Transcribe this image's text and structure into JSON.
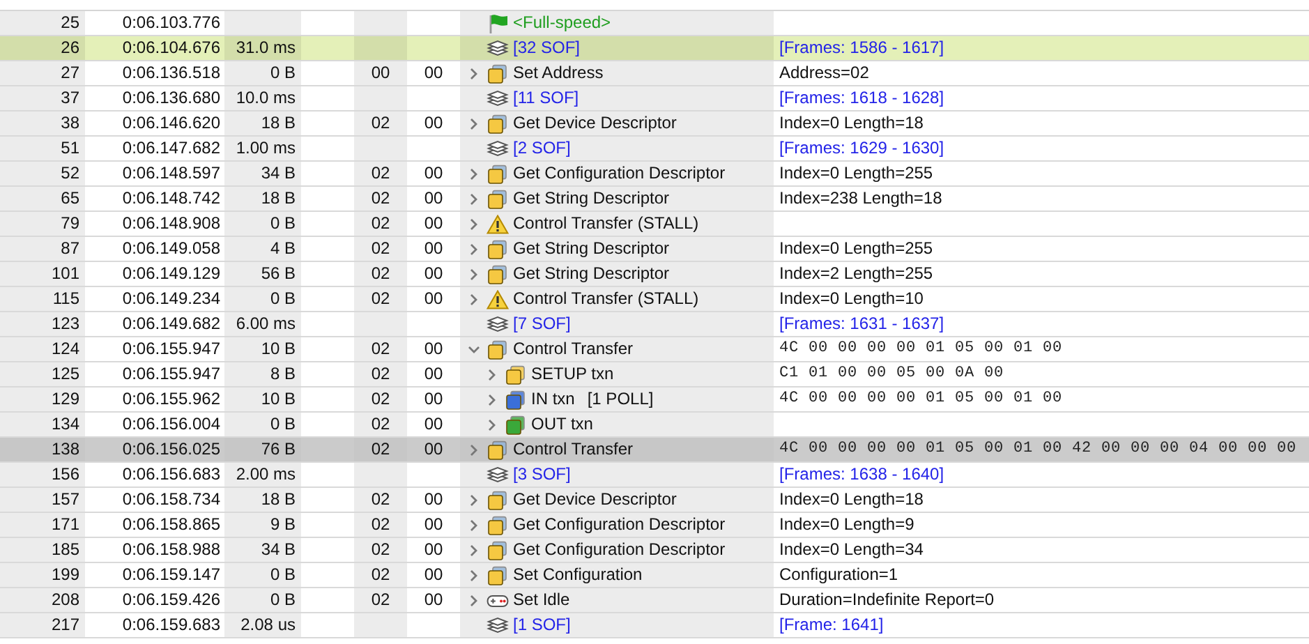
{
  "rows": [
    {
      "index": "25",
      "time": "0:06.103.776",
      "kind": "flag",
      "record": "<Full-speed>",
      "expandable": false,
      "selected": false,
      "highlighted": false
    },
    {
      "index": "26",
      "time": "0:06.104.676",
      "len": "31.0 ms",
      "kind": "sof",
      "record": "[32 SOF]",
      "summary": {
        "kind": "link",
        "text": "[Frames: 1586 - 1617]"
      },
      "expandable": false,
      "selected": false,
      "highlighted": true
    },
    {
      "index": "27",
      "time": "0:06.136.518",
      "len": "0 B",
      "dev": "00",
      "ep": "00",
      "kind": "transfer",
      "record": "Set Address",
      "summary": {
        "kind": "text",
        "text": "Address=02"
      },
      "expandable": true,
      "expanded": false,
      "selected": false,
      "highlighted": false
    },
    {
      "index": "37",
      "time": "0:06.136.680",
      "len": "10.0 ms",
      "kind": "sof",
      "record": "[11 SOF]",
      "summary": {
        "kind": "link",
        "text": "[Frames: 1618 - 1628]"
      },
      "expandable": false,
      "selected": false,
      "highlighted": false
    },
    {
      "index": "38",
      "time": "0:06.146.620",
      "len": "18 B",
      "dev": "02",
      "ep": "00",
      "kind": "transfer",
      "record": "Get Device Descriptor",
      "summary": {
        "kind": "text",
        "text": "Index=0 Length=18"
      },
      "expandable": true,
      "expanded": false,
      "selected": false,
      "highlighted": false
    },
    {
      "index": "51",
      "time": "0:06.147.682",
      "len": "1.00 ms",
      "kind": "sof",
      "record": "[2 SOF]",
      "summary": {
        "kind": "link",
        "text": "[Frames: 1629 - 1630]"
      },
      "expandable": false,
      "selected": false,
      "highlighted": false
    },
    {
      "index": "52",
      "time": "0:06.148.597",
      "len": "34 B",
      "dev": "02",
      "ep": "00",
      "kind": "transfer",
      "record": "Get Configuration Descriptor",
      "summary": {
        "kind": "text",
        "text": "Index=0 Length=255"
      },
      "expandable": true,
      "expanded": false,
      "selected": false,
      "highlighted": false
    },
    {
      "index": "65",
      "time": "0:06.148.742",
      "len": "18 B",
      "dev": "02",
      "ep": "00",
      "kind": "transfer",
      "record": "Get String Descriptor",
      "summary": {
        "kind": "text",
        "text": "Index=238 Length=18"
      },
      "expandable": true,
      "expanded": false,
      "selected": false,
      "highlighted": false
    },
    {
      "index": "79",
      "time": "0:06.148.908",
      "len": "0 B",
      "dev": "02",
      "ep": "00",
      "kind": "warning",
      "record": "Control Transfer (STALL)",
      "expandable": true,
      "expanded": false,
      "selected": false,
      "highlighted": false
    },
    {
      "index": "87",
      "time": "0:06.149.058",
      "len": "4 B",
      "dev": "02",
      "ep": "00",
      "kind": "transfer",
      "record": "Get String Descriptor",
      "summary": {
        "kind": "text",
        "text": "Index=0 Length=255"
      },
      "expandable": true,
      "expanded": false,
      "selected": false,
      "highlighted": false
    },
    {
      "index": "101",
      "time": "0:06.149.129",
      "len": "56 B",
      "dev": "02",
      "ep": "00",
      "kind": "transfer",
      "record": "Get String Descriptor",
      "summary": {
        "kind": "text",
        "text": "Index=2 Length=255"
      },
      "expandable": true,
      "expanded": false,
      "selected": false,
      "highlighted": false
    },
    {
      "index": "115",
      "time": "0:06.149.234",
      "len": "0 B",
      "dev": "02",
      "ep": "00",
      "kind": "warning",
      "record": "Control Transfer (STALL)",
      "summary": {
        "kind": "text",
        "text": "Index=0 Length=10"
      },
      "expandable": true,
      "expanded": false,
      "selected": false,
      "highlighted": false
    },
    {
      "index": "123",
      "time": "0:06.149.682",
      "len": "6.00 ms",
      "kind": "sof",
      "record": "[7 SOF]",
      "summary": {
        "kind": "link",
        "text": "[Frames: 1631 - 1637]"
      },
      "expandable": false,
      "selected": false,
      "highlighted": false
    },
    {
      "index": "124",
      "time": "0:06.155.947",
      "len": "10 B",
      "dev": "02",
      "ep": "00",
      "kind": "transfer",
      "record": "Control Transfer",
      "summary": {
        "kind": "hex",
        "text": "4C 00 00 00 00 01 05 00 01 00"
      },
      "expandable": true,
      "expanded": true,
      "selected": false,
      "highlighted": false,
      "children": [
        {
          "index": "125",
          "time": "0:06.155.947",
          "len": "8 B",
          "dev": "02",
          "ep": "00",
          "kind": "setup",
          "record": "SETUP txn",
          "summary": {
            "kind": "hex",
            "text": "C1 01 00 00 05 00 0A 00"
          },
          "expandable": true,
          "expanded": false,
          "selected": false,
          "highlighted": false
        },
        {
          "index": "129",
          "time": "0:06.155.962",
          "len": "10 B",
          "dev": "02",
          "ep": "00",
          "kind": "in",
          "record": "IN txn",
          "note": "[1 POLL]",
          "summary": {
            "kind": "hex",
            "text": "4C 00 00 00 00 01 05 00 01 00"
          },
          "expandable": true,
          "expanded": false,
          "selected": false,
          "highlighted": false
        },
        {
          "index": "134",
          "time": "0:06.156.004",
          "len": "0 B",
          "dev": "02",
          "ep": "00",
          "kind": "out",
          "record": "OUT txn",
          "expandable": true,
          "expanded": false,
          "selected": false,
          "highlighted": false
        }
      ]
    },
    {
      "index": "138",
      "time": "0:06.156.025",
      "len": "76 B",
      "dev": "02",
      "ep": "00",
      "kind": "transfer",
      "record": "Control Transfer",
      "summary": {
        "kind": "hex",
        "text": "4C 00 00 00 00 01 05 00 01 00 42 00 00 00 04 00 00 00"
      },
      "expandable": true,
      "expanded": false,
      "selected": true,
      "highlighted": false
    },
    {
      "index": "156",
      "time": "0:06.156.683",
      "len": "2.00 ms",
      "kind": "sof",
      "record": "[3 SOF]",
      "summary": {
        "kind": "link",
        "text": "[Frames: 1638 - 1640]"
      },
      "expandable": false,
      "selected": false,
      "highlighted": false
    },
    {
      "index": "157",
      "time": "0:06.158.734",
      "len": "18 B",
      "dev": "02",
      "ep": "00",
      "kind": "transfer",
      "record": "Get Device Descriptor",
      "summary": {
        "kind": "text",
        "text": "Index=0 Length=18"
      },
      "expandable": true,
      "expanded": false,
      "selected": false,
      "highlighted": false
    },
    {
      "index": "171",
      "time": "0:06.158.865",
      "len": "9 B",
      "dev": "02",
      "ep": "00",
      "kind": "transfer",
      "record": "Get Configuration Descriptor",
      "summary": {
        "kind": "text",
        "text": "Index=0 Length=9"
      },
      "expandable": true,
      "expanded": false,
      "selected": false,
      "highlighted": false
    },
    {
      "index": "185",
      "time": "0:06.158.988",
      "len": "34 B",
      "dev": "02",
      "ep": "00",
      "kind": "transfer",
      "record": "Get Configuration Descriptor",
      "summary": {
        "kind": "text",
        "text": "Index=0 Length=34"
      },
      "expandable": true,
      "expanded": false,
      "selected": false,
      "highlighted": false
    },
    {
      "index": "199",
      "time": "0:06.159.147",
      "len": "0 B",
      "dev": "02",
      "ep": "00",
      "kind": "transfer",
      "record": "Set Configuration",
      "summary": {
        "kind": "text",
        "text": "Configuration=1"
      },
      "expandable": true,
      "expanded": false,
      "selected": false,
      "highlighted": false
    },
    {
      "index": "208",
      "time": "0:06.159.426",
      "len": "0 B",
      "dev": "02",
      "ep": "00",
      "kind": "hid",
      "record": "Set Idle",
      "summary": {
        "kind": "text",
        "text": "Duration=Indefinite Report=0"
      },
      "expandable": true,
      "expanded": false,
      "selected": false,
      "highlighted": false
    },
    {
      "index": "217",
      "time": "0:06.159.683",
      "len": "2.08 us",
      "kind": "sof",
      "record": "[1 SOF]",
      "summary": {
        "kind": "link",
        "text": "[Frame: 1641]"
      },
      "expandable": false,
      "selected": false,
      "highlighted": false
    }
  ]
}
